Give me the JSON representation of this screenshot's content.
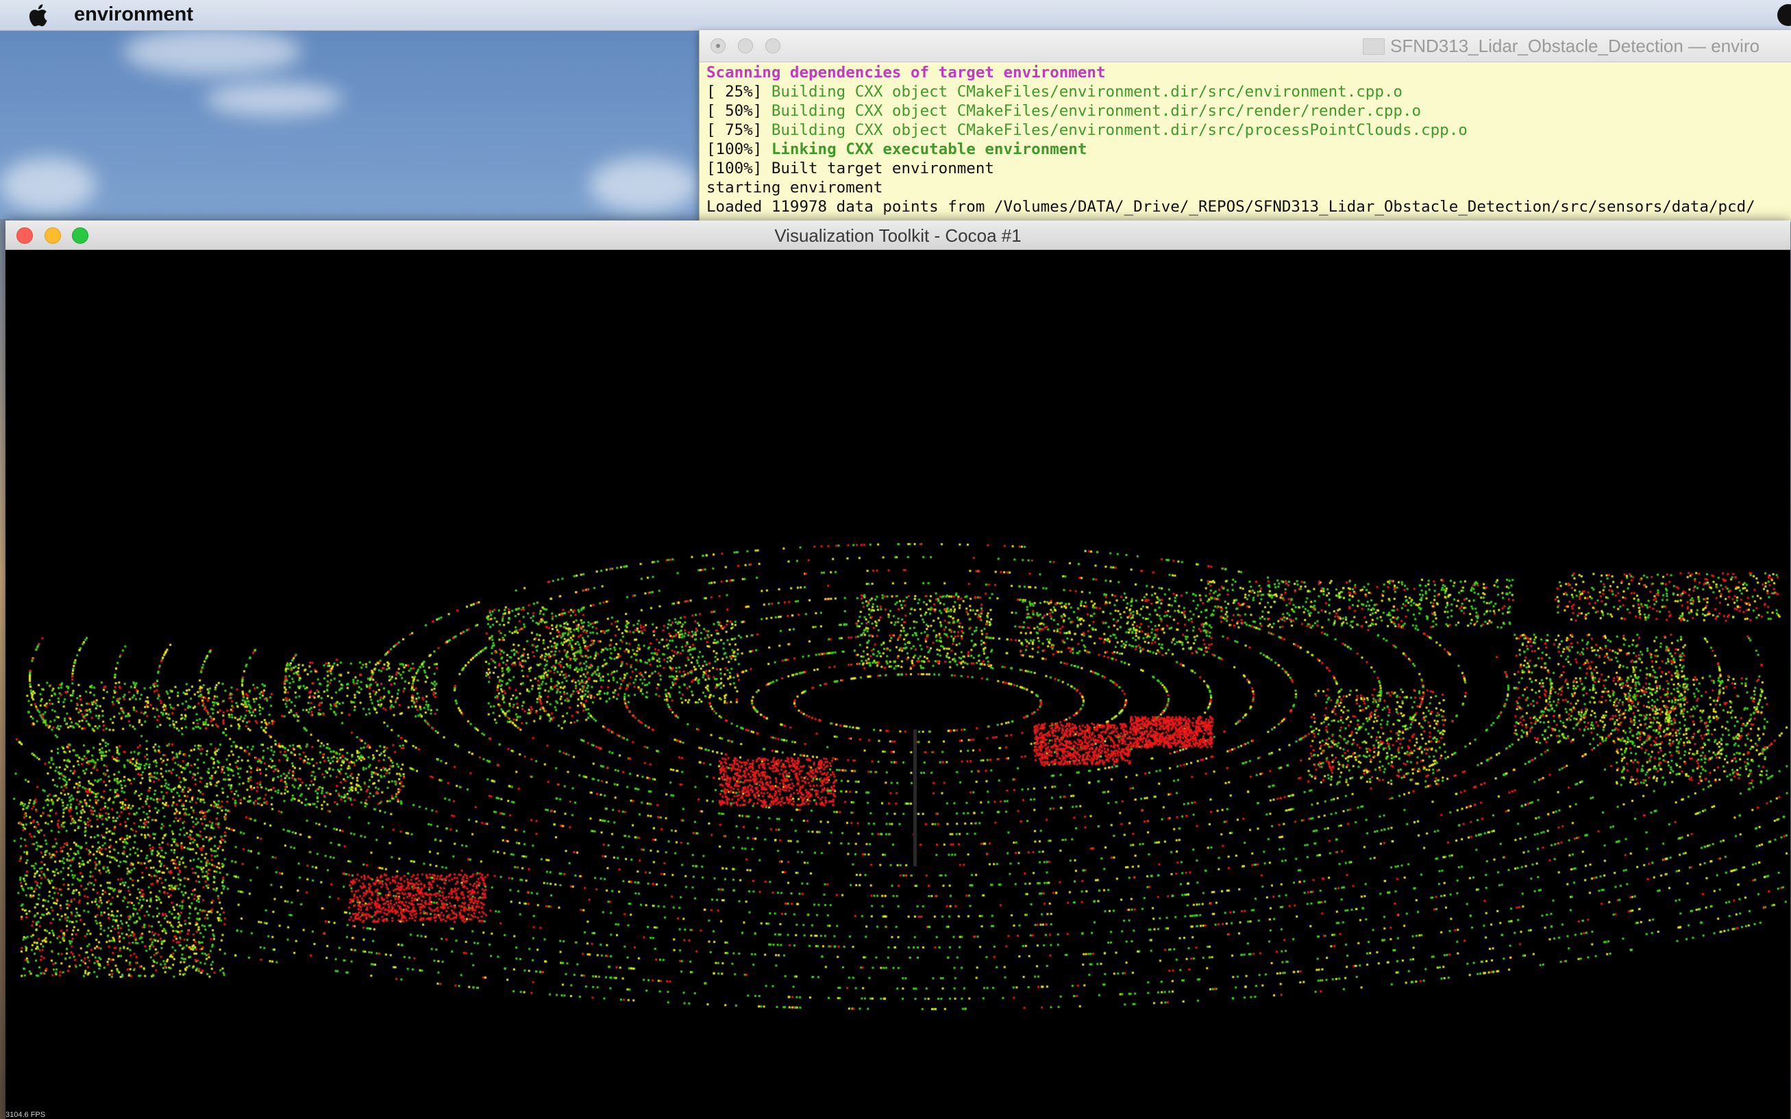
{
  "menubar": {
    "app_name": "environment"
  },
  "terminal": {
    "title": "SFND313_Lidar_Obstacle_Detection — enviro",
    "lines": [
      {
        "prefix": "",
        "text": "Scanning dependencies of target environment"
      },
      {
        "prefix": "[ 25%] ",
        "text": "Building CXX object CMakeFiles/environment.dir/src/environment.cpp.o"
      },
      {
        "prefix": "[ 50%] ",
        "text": "Building CXX object CMakeFiles/environment.dir/src/render/render.cpp.o"
      },
      {
        "prefix": "[ 75%] ",
        "text": "Building CXX object CMakeFiles/environment.dir/src/processPointClouds.cpp.o"
      },
      {
        "prefix": "[100%] ",
        "text": "Linking CXX executable environment"
      },
      {
        "prefix": "",
        "text": "[100%] Built target environment"
      },
      {
        "prefix": "",
        "text": "starting enviroment"
      },
      {
        "prefix": "",
        "text": "Loaded 119978 data points from /Volumes/DATA/_Drive/_REPOS/SFND313_Lidar_Obstacle_Detection/src/sensors/data/pcd/"
      }
    ]
  },
  "vtk_window": {
    "title": "Visualization Toolkit - Cocoa #1",
    "fps": "3104.6 FPS"
  },
  "colors": {
    "point_green": "#3fd21a",
    "point_yellow": "#e8e81a",
    "point_red": "#e81a1a",
    "terminal_bg": "#fafacc"
  }
}
